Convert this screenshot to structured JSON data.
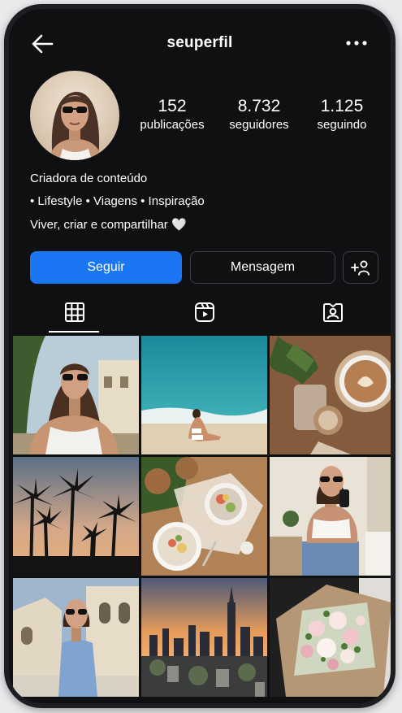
{
  "header": {
    "username": "seuperfil"
  },
  "stats": [
    {
      "number": "152",
      "label": "publicações"
    },
    {
      "number": "8.732",
      "label": "seguidores"
    },
    {
      "number": "1.125",
      "label": "seguindo"
    }
  ],
  "bio": {
    "line1": "Criadora de conteúdo",
    "line2": "• Lifestyle • Viagens • Inspiração",
    "line3": "Viver, criar e compartilhar 🤍"
  },
  "actions": {
    "follow": "Seguir",
    "message": "Mensagem"
  },
  "tabs": [
    "grid-icon",
    "reels-icon",
    "tagged-icon"
  ],
  "colors": {
    "accent": "#1a76f2",
    "background": "#0f1012",
    "border": "#3b3d42"
  }
}
